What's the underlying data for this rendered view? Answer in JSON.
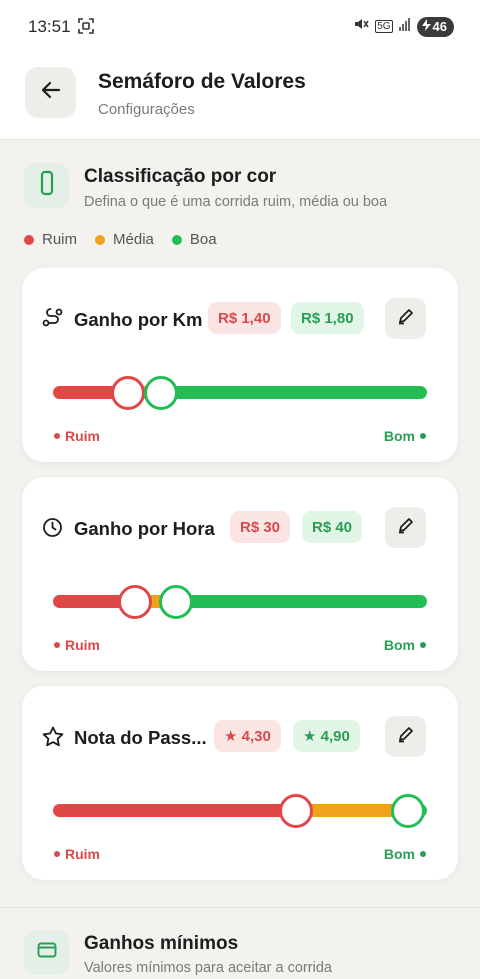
{
  "status_bar": {
    "time": "13:51",
    "network": "5G",
    "battery": "46",
    "icons": [
      "screenshot-scan-icon",
      "mute-icon",
      "signal-icon",
      "charging-icon"
    ]
  },
  "header": {
    "title": "Semáforo de Valores",
    "subtitle": "Configurações",
    "back_icon": "arrow-left-icon"
  },
  "classification": {
    "icon": "phone-outline-icon",
    "title": "Classificação por cor",
    "subtitle": "Defina o que é uma corrida ruim, média ou boa",
    "legend": [
      {
        "label": "Ruim",
        "color": "#e04848"
      },
      {
        "label": "Média",
        "color": "#f0a21a"
      },
      {
        "label": "Boa",
        "color": "#22bd55"
      }
    ]
  },
  "colors": {
    "red": "#e04848",
    "orange": "#f0a21a",
    "green": "#22bd55"
  },
  "cards": [
    {
      "icon": "route-icon",
      "title": "Ganho por Km",
      "low_value": "R$ 1,40",
      "high_value": "R$ 1,80",
      "low_level": 0.2,
      "high_level": 0.29,
      "ruim_label": "Ruim",
      "bom_label": "Bom",
      "edit_icon": "pencil-icon"
    },
    {
      "icon": "clock-icon",
      "title": "Ganho por Hora",
      "low_value": "R$ 30",
      "high_value": "R$ 40",
      "low_level": 0.22,
      "high_level": 0.33,
      "ruim_label": "Ruim",
      "bom_label": "Bom",
      "edit_icon": "pencil-icon"
    },
    {
      "icon": "star-outline-icon",
      "title": "Nota do Pass...",
      "low_value": "★ 4,30",
      "high_value": "★ 4,90",
      "low_level": 0.65,
      "high_level": 0.95,
      "ruim_label": "Ruim",
      "bom_label": "Bom",
      "edit_icon": "pencil-icon"
    }
  ],
  "minimums": {
    "icon": "wallet-icon",
    "title": "Ganhos mínimos",
    "subtitle": "Valores mínimos para aceitar a corrida"
  }
}
